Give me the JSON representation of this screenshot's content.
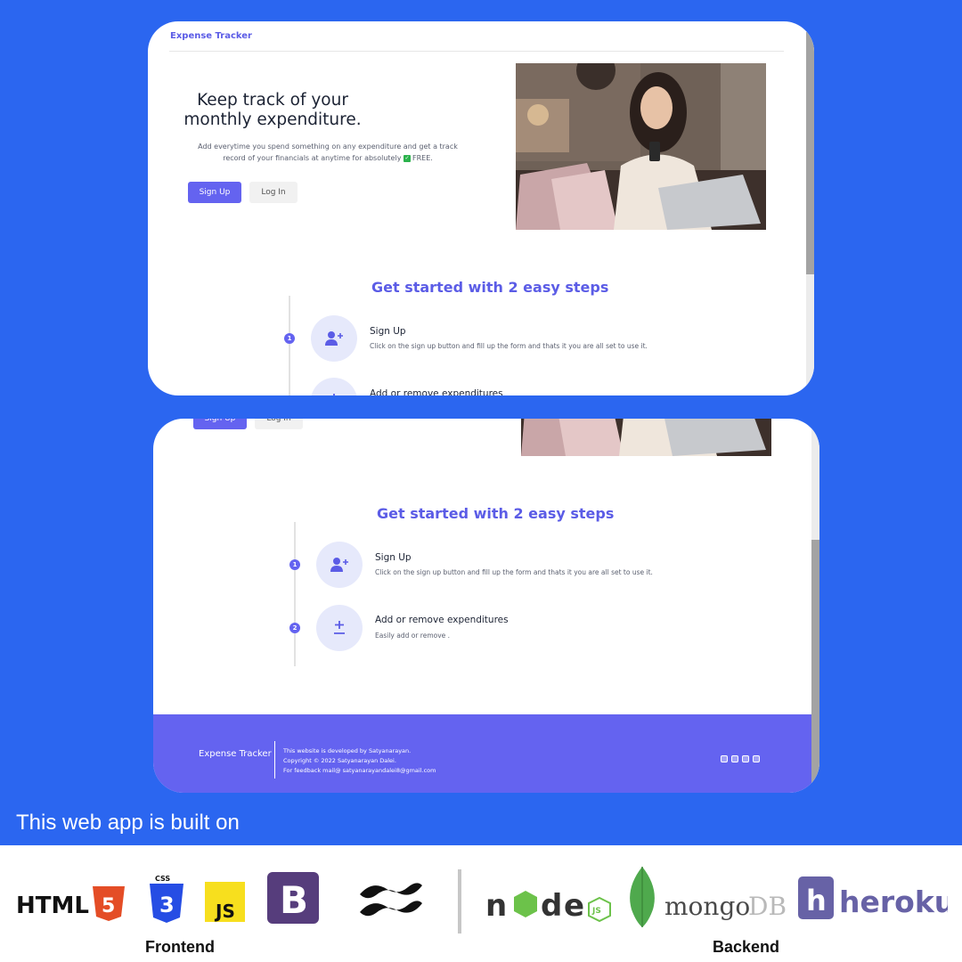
{
  "screen1": {
    "brand": "Expense Tracker",
    "hero": {
      "title": "Keep track of your monthly expenditure.",
      "description_pre": "Add everytime you spend something on any expenditure and get a track record of your financials at anytime for absolutely",
      "check_glyph": "✓",
      "description_post": "FREE.",
      "signup_label": "Sign Up",
      "login_label": "Log In"
    },
    "steps_title": "Get started with 2 easy steps",
    "steps": [
      {
        "number": "1",
        "title": "Sign Up",
        "desc": "Click on the sign up button and fill up the form and thats it you are all set to use it."
      },
      {
        "number": "2",
        "title": "Add or remove expenditures",
        "desc": ""
      }
    ]
  },
  "screen2": {
    "signup_label": "Sign Up",
    "login_label": "Log In",
    "steps_title": "Get started with 2 easy steps",
    "steps": [
      {
        "number": "1",
        "title": "Sign Up",
        "desc": "Click on the sign up button and fill up the form and thats it you are all set to use it."
      },
      {
        "number": "2",
        "title": "Add or remove expenditures",
        "desc": "Easily add or remove ."
      }
    ],
    "footer": {
      "brand": "Expense Tracker",
      "line1": "This website is developed by Satyanarayan.",
      "line2": "Copyright © 2022 Satyanarayan Dalei.",
      "line3": "For feedback mail@ satyanarayandalei8@gmail.com",
      "social_icons": [
        "linkedin-icon",
        "twitter-icon",
        "github-icon",
        "instagram-icon"
      ]
    }
  },
  "built_on": "This web app is built on",
  "frontend": {
    "label": "Frontend",
    "html_text": "HTML",
    "html_badge": "5",
    "css_text": "CSS",
    "css_badge": "3",
    "js_text": "JS",
    "bootstrap_text": "B"
  },
  "backend": {
    "label": "Backend",
    "mongo_text_a": "mongo",
    "mongo_text_b": "DB",
    "heroku_text": "heroku",
    "heroku_badge": "h",
    "node_text_n": "n",
    "node_text_d": "d",
    "node_text_e": "e",
    "node_badge": "JS"
  },
  "colors": {
    "background": "#2b66f0",
    "accent": "#5b5ce6",
    "button": "#6463f0",
    "footer": "#6463f0"
  }
}
